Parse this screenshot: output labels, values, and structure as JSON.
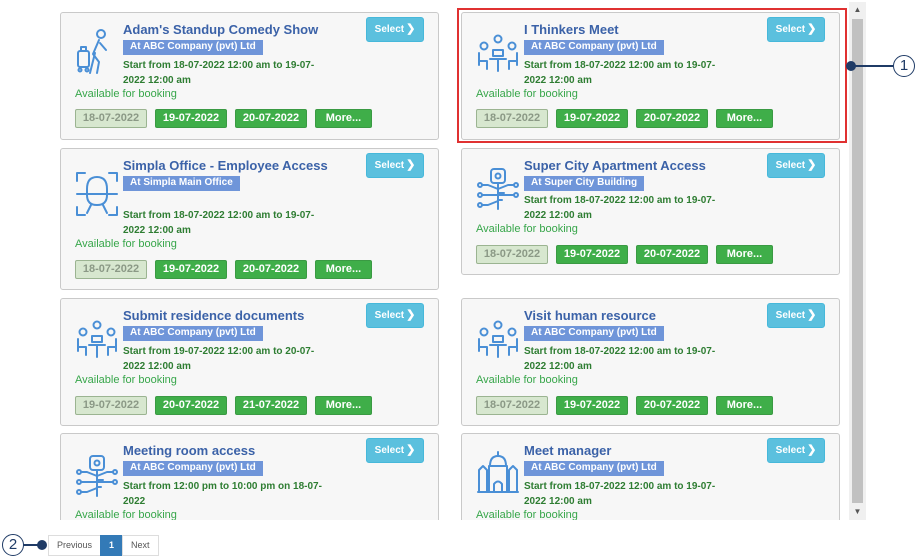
{
  "select_label": "Select",
  "more_label": "More...",
  "avail_label": "Available for booking",
  "cards": [
    {
      "title": "Adam's Standup Comedy Show",
      "location": "At ABC Company (pvt) Ltd",
      "time": "Start from 18-07-2022 12:00 am to 19-07-2022 12:00 am",
      "dates": [
        "18-07-2022",
        "19-07-2022",
        "20-07-2022"
      ],
      "icon": "traveler-icon"
    },
    {
      "title": "I Thinkers Meet",
      "location": "At ABC Company (pvt) Ltd",
      "time": "Start from 18-07-2022 12:00 am to 19-07-2022 12:00 am",
      "dates": [
        "18-07-2022",
        "19-07-2022",
        "20-07-2022"
      ],
      "icon": "meeting-icon"
    },
    {
      "title": "Simpla Office - Employee Access",
      "location": "At Simpla Main Office",
      "time": "Start from 18-07-2022 12:00 am to 19-07-2022 12:00 am",
      "dates": [
        "18-07-2022",
        "19-07-2022",
        "20-07-2022"
      ],
      "icon": "face-scan-icon"
    },
    {
      "title": "Super City Apartment Access",
      "location": "At Super City Building",
      "time": "Start from 18-07-2022 12:00 am to 19-07-2022 12:00 am",
      "dates": [
        "18-07-2022",
        "19-07-2022",
        "20-07-2022"
      ],
      "icon": "digital-key-icon"
    },
    {
      "title": "Submit residence documents",
      "location": "At ABC Company (pvt) Ltd",
      "time": "Start from 19-07-2022 12:00 am to 20-07-2022 12:00 am",
      "dates": [
        "19-07-2022",
        "20-07-2022",
        "21-07-2022"
      ],
      "icon": "meeting-icon"
    },
    {
      "title": "Visit human resource",
      "location": "At ABC Company (pvt) Ltd",
      "time": "Start from 18-07-2022 12:00 am to 19-07-2022 12:00 am",
      "dates": [
        "18-07-2022",
        "19-07-2022",
        "20-07-2022"
      ],
      "icon": "meeting-icon"
    },
    {
      "title": "Meeting room access",
      "location": "At ABC Company (pvt) Ltd",
      "time": "Start from 12:00 pm to 10:00 pm on 18-07-2022",
      "dates": [],
      "icon": "digital-key-icon"
    },
    {
      "title": "Meet manager",
      "location": "At ABC Company (pvt) Ltd",
      "time": "Start from 18-07-2022 12:00 am to 19-07-2022 12:00 am",
      "dates": [],
      "icon": "building-icon"
    }
  ],
  "pagination": {
    "previous": "Previous",
    "current": "1",
    "next": "Next"
  },
  "callouts": [
    "1",
    "2"
  ],
  "colors": {
    "title": "#3b62a8",
    "location_badge": "#6f95d9",
    "chip": "#3fae49",
    "select": "#5bc0de",
    "highlight": "#e03131"
  }
}
